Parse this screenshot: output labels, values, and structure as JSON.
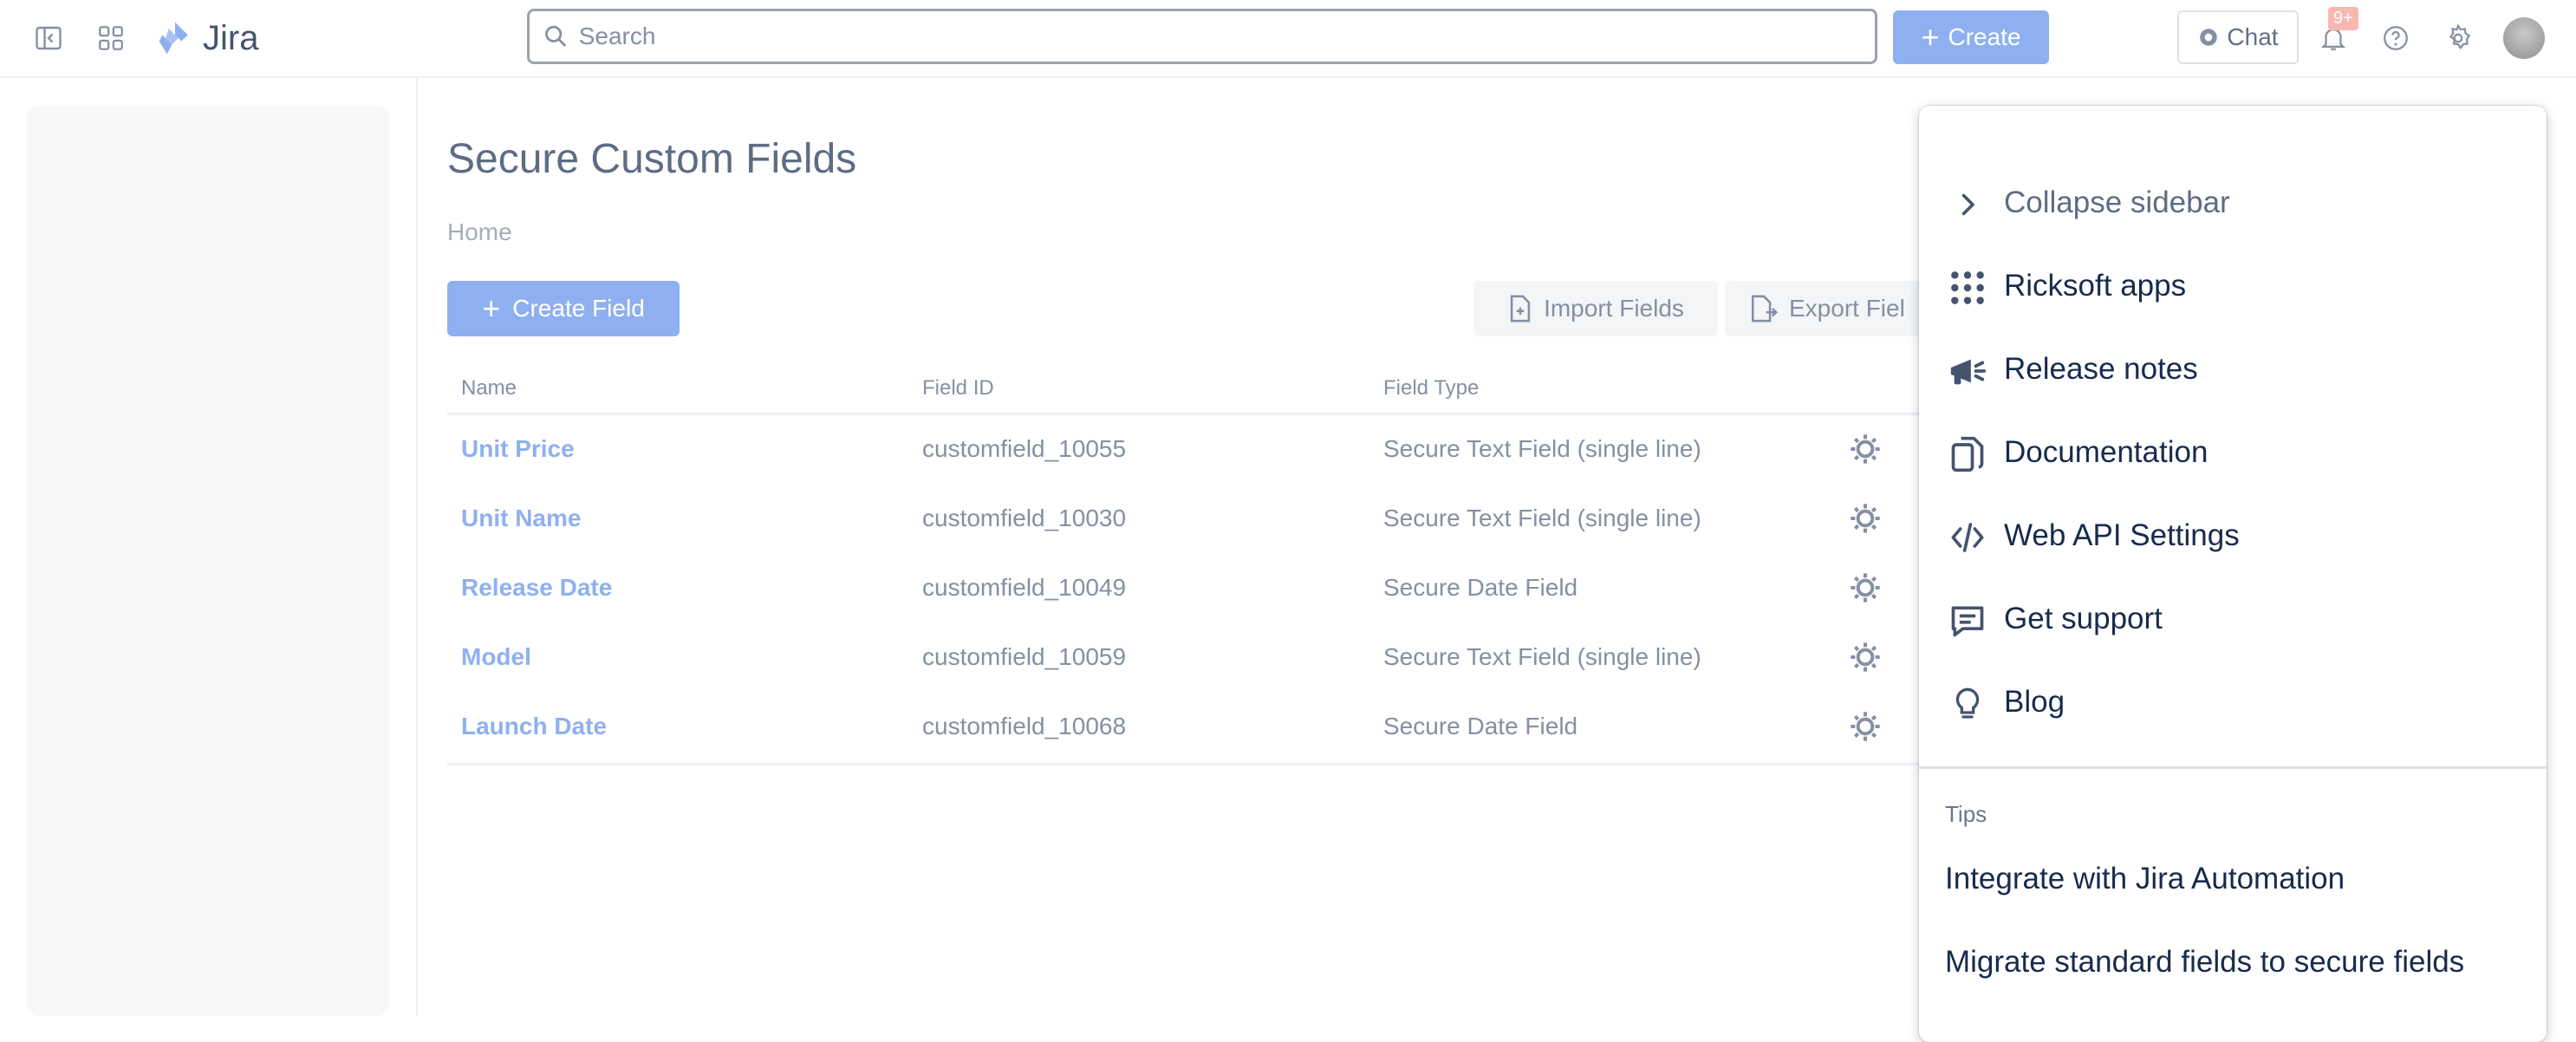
{
  "topbar": {
    "app_name": "Jira",
    "search_placeholder": "Search",
    "create_label": "Create",
    "chat_label": "Chat",
    "notification_badge": "9+"
  },
  "page": {
    "title": "Secure Custom Fields",
    "breadcrumb": "Home",
    "create_field_label": "Create Field",
    "import_label": "Import Fields",
    "export_label": "Export Fiel"
  },
  "table": {
    "headers": [
      "Name",
      "Field ID",
      "Field Type"
    ],
    "rows": [
      {
        "name": "Unit Price",
        "id": "customfield_10055",
        "type": "Secure Text Field (single line)"
      },
      {
        "name": "Unit Name",
        "id": "customfield_10030",
        "type": "Secure Text Field (single line)"
      },
      {
        "name": "Release Date",
        "id": "customfield_10049",
        "type": "Secure Date Field"
      },
      {
        "name": "Model",
        "id": "customfield_10059",
        "type": "Secure Text Field (single line)"
      },
      {
        "name": "Launch Date",
        "id": "customfield_10068",
        "type": "Secure Date Field"
      }
    ]
  },
  "menu": {
    "items": [
      {
        "label": "Collapse sidebar",
        "icon": "chevron-right-icon"
      },
      {
        "label": "Ricksoft apps",
        "icon": "app-grid-icon"
      },
      {
        "label": "Release notes",
        "icon": "megaphone-icon"
      },
      {
        "label": "Documentation",
        "icon": "copy-document-icon"
      },
      {
        "label": "Web API Settings",
        "icon": "code-icon"
      },
      {
        "label": "Get support",
        "icon": "chat-comment-icon"
      },
      {
        "label": "Blog",
        "icon": "lightbulb-icon"
      }
    ],
    "tips_heading": "Tips",
    "tips": [
      "Integrate with Jira Automation",
      "Migrate standard fields to secure fields"
    ]
  },
  "colors": {
    "brand_blue": "#0c66e4",
    "dimmed_blue": "#8fb0f0",
    "text_dark": "#172b4d",
    "badge_red": "#f7b8b0"
  }
}
